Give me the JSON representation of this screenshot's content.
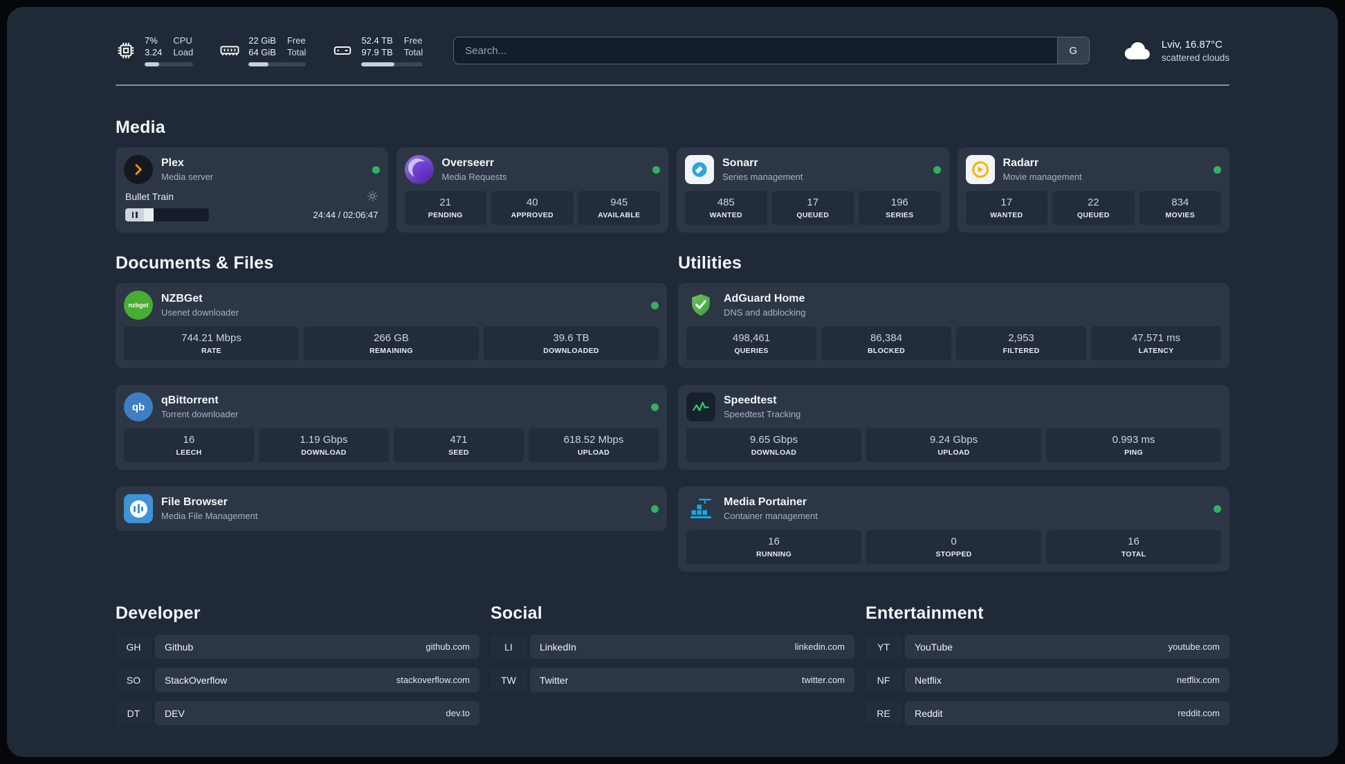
{
  "theme": {
    "status_online": "#35b05f"
  },
  "topbar": {
    "cpu": {
      "value_top": "7%",
      "value_bottom": "3.24",
      "label_top": "CPU",
      "label_bottom": "Load",
      "bar_percent": 30
    },
    "ram": {
      "value_top": "22 GiB",
      "value_bottom": "64 GiB",
      "label_top": "Free",
      "label_bottom": "Total",
      "bar_percent": 35
    },
    "disk": {
      "value_top": "52.4 TB",
      "value_bottom": "97.9 TB",
      "label_top": "Free",
      "label_bottom": "Total",
      "bar_percent": 54
    },
    "search": {
      "placeholder": "Search...",
      "button_label": "G"
    },
    "weather": {
      "location": "Lviv, 16.87°C",
      "condition": "scattered clouds"
    }
  },
  "media": {
    "title": "Media",
    "plex": {
      "name": "Plex",
      "subtitle": "Media server",
      "now_playing": "Bullet Train",
      "time": "24:44 / 02:06:47",
      "progress_percent": 15
    },
    "overseerr": {
      "name": "Overseerr",
      "subtitle": "Media Requests",
      "stats": [
        {
          "value": "21",
          "label": "PENDING"
        },
        {
          "value": "40",
          "label": "APPROVED"
        },
        {
          "value": "945",
          "label": "AVAILABLE"
        }
      ]
    },
    "sonarr": {
      "name": "Sonarr",
      "subtitle": "Series management",
      "stats": [
        {
          "value": "485",
          "label": "WANTED"
        },
        {
          "value": "17",
          "label": "QUEUED"
        },
        {
          "value": "196",
          "label": "SERIES"
        }
      ]
    },
    "radarr": {
      "name": "Radarr",
      "subtitle": "Movie management",
      "stats": [
        {
          "value": "17",
          "label": "WANTED"
        },
        {
          "value": "22",
          "label": "QUEUED"
        },
        {
          "value": "834",
          "label": "MOVIES"
        }
      ]
    }
  },
  "documents": {
    "title": "Documents & Files",
    "nzbget": {
      "name": "NZBGet",
      "subtitle": "Usenet downloader",
      "stats": [
        {
          "value": "744.21 Mbps",
          "label": "RATE"
        },
        {
          "value": "266 GB",
          "label": "REMAINING"
        },
        {
          "value": "39.6 TB",
          "label": "DOWNLOADED"
        }
      ]
    },
    "qbittorrent": {
      "name": "qBittorrent",
      "subtitle": "Torrent downloader",
      "stats": [
        {
          "value": "16",
          "label": "LEECH"
        },
        {
          "value": "1.19 Gbps",
          "label": "DOWNLOAD"
        },
        {
          "value": "471",
          "label": "SEED"
        },
        {
          "value": "618.52 Mbps",
          "label": "UPLOAD"
        }
      ]
    },
    "filebrowser": {
      "name": "File Browser",
      "subtitle": "Media File Management"
    }
  },
  "utilities": {
    "title": "Utilities",
    "adguard": {
      "name": "AdGuard Home",
      "subtitle": "DNS and adblocking",
      "stats": [
        {
          "value": "498,461",
          "label": "QUERIES"
        },
        {
          "value": "86,384",
          "label": "BLOCKED"
        },
        {
          "value": "2,953",
          "label": "FILTERED"
        },
        {
          "value": "47.571 ms",
          "label": "LATENCY"
        }
      ]
    },
    "speedtest": {
      "name": "Speedtest",
      "subtitle": "Speedtest Tracking",
      "stats": [
        {
          "value": "9.65 Gbps",
          "label": "DOWNLOAD"
        },
        {
          "value": "9.24 Gbps",
          "label": "UPLOAD"
        },
        {
          "value": "0.993 ms",
          "label": "PING"
        }
      ]
    },
    "portainer": {
      "name": "Media Portainer",
      "subtitle": "Container management",
      "stats": [
        {
          "value": "16",
          "label": "RUNNING"
        },
        {
          "value": "0",
          "label": "STOPPED"
        },
        {
          "value": "16",
          "label": "TOTAL"
        }
      ]
    }
  },
  "bookmarks": {
    "developer": {
      "title": "Developer",
      "items": [
        {
          "abbr": "GH",
          "name": "Github",
          "url": "github.com"
        },
        {
          "abbr": "SO",
          "name": "StackOverflow",
          "url": "stackoverflow.com"
        },
        {
          "abbr": "DT",
          "name": "DEV",
          "url": "dev.to"
        }
      ]
    },
    "social": {
      "title": "Social",
      "items": [
        {
          "abbr": "LI",
          "name": "LinkedIn",
          "url": "linkedin.com"
        },
        {
          "abbr": "TW",
          "name": "Twitter",
          "url": "twitter.com"
        }
      ]
    },
    "entertainment": {
      "title": "Entertainment",
      "items": [
        {
          "abbr": "YT",
          "name": "YouTube",
          "url": "youtube.com"
        },
        {
          "abbr": "NF",
          "name": "Netflix",
          "url": "netflix.com"
        },
        {
          "abbr": "RE",
          "name": "Reddit",
          "url": "reddit.com"
        }
      ]
    }
  },
  "icon_text": {
    "nzbget": "nzbget",
    "qbittorrent": "qb"
  }
}
